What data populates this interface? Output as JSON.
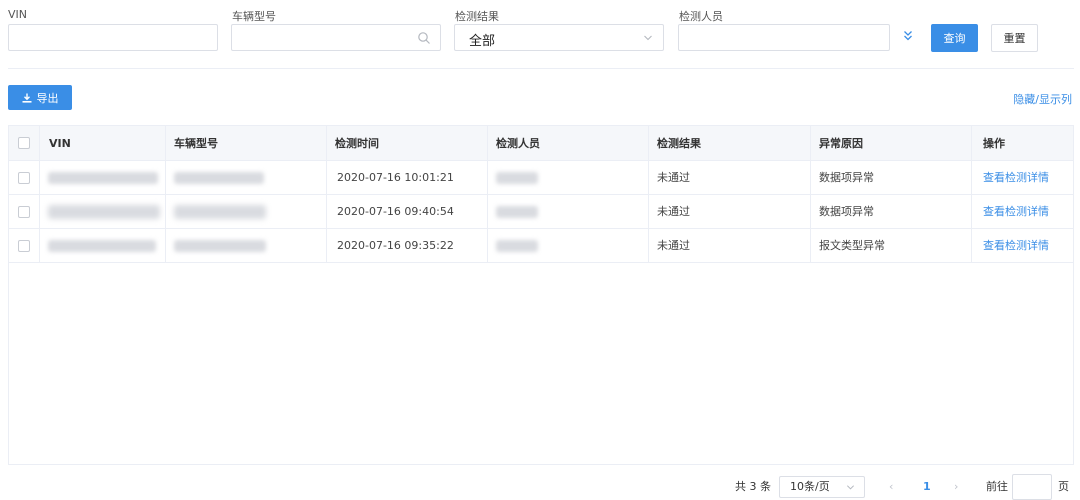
{
  "filters": {
    "vin": {
      "label": "VIN",
      "value": ""
    },
    "model": {
      "label": "车辆型号",
      "value": ""
    },
    "result": {
      "label": "检测结果",
      "value": "全部"
    },
    "inspector": {
      "label": "检测人员",
      "value": ""
    },
    "query_label": "查询",
    "reset_label": "重置"
  },
  "toolbar": {
    "export_label": "导出",
    "toggle_columns_label": "隐藏/显示列"
  },
  "table": {
    "headers": [
      "VIN",
      "车辆型号",
      "检测时间",
      "检测人员",
      "检测结果",
      "异常原因",
      "操作"
    ],
    "rows": [
      {
        "time": "2020-07-16 10:01:21",
        "result": "未通过",
        "reason": "数据项异常",
        "action": "查看检测详情"
      },
      {
        "time": "2020-07-16 09:40:54",
        "result": "未通过",
        "reason": "数据项异常",
        "action": "查看检测详情"
      },
      {
        "time": "2020-07-16 09:35:22",
        "result": "未通过",
        "reason": "报文类型异常",
        "action": "查看检测详情"
      }
    ]
  },
  "pagination": {
    "total_text": "共 3 条",
    "page_size": "10条/页",
    "prev": "‹",
    "current_page": "1",
    "next": "›",
    "goto_label": "前往",
    "goto_value": "",
    "page_suffix": "页"
  },
  "colors": {
    "primary": "#3a8ee6",
    "header_bg": "#f5f7fa",
    "border": "#ebeef5"
  }
}
